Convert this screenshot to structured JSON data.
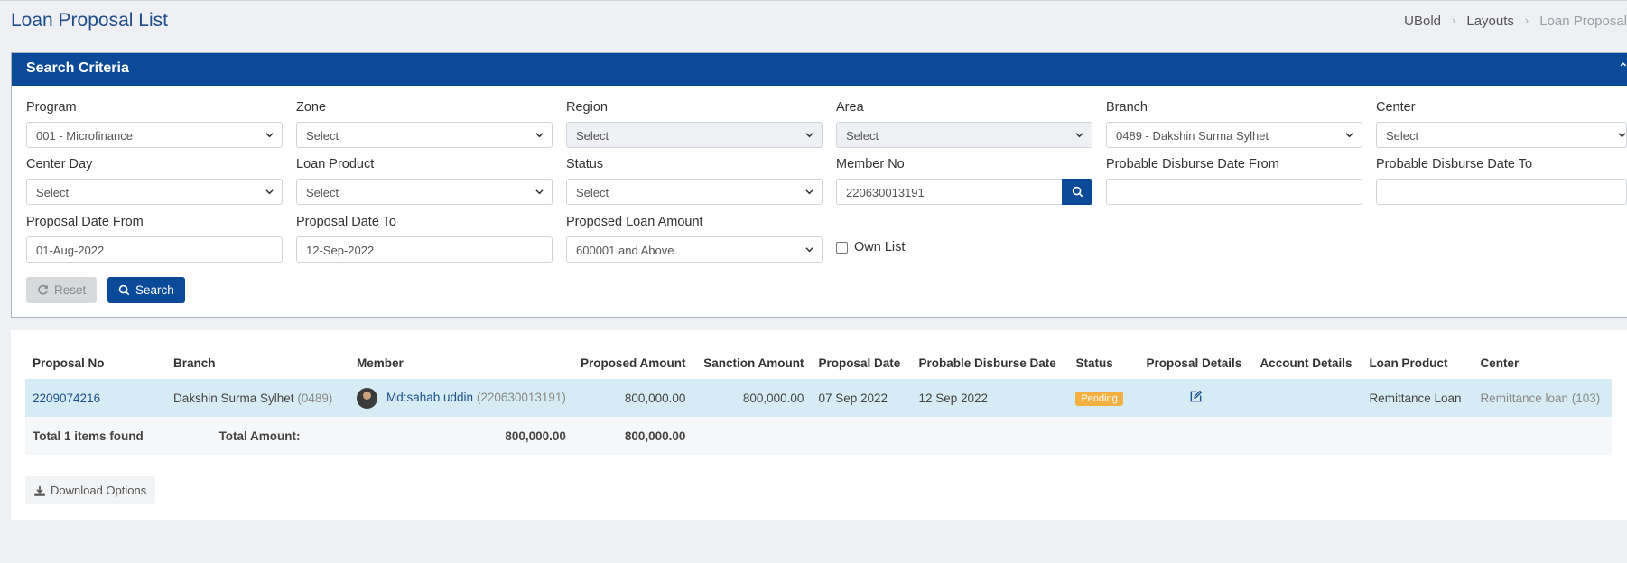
{
  "header": {
    "title": "Loan Proposal List",
    "breadcrumb": [
      "UBold",
      "Layouts",
      "Loan Proposal"
    ]
  },
  "search": {
    "title": "Search Criteria",
    "fields": {
      "program": {
        "label": "Program",
        "value": "001 - Microfinance"
      },
      "zone": {
        "label": "Zone",
        "value": "Select"
      },
      "region": {
        "label": "Region",
        "value": "Select"
      },
      "area": {
        "label": "Area",
        "value": "Select"
      },
      "branch": {
        "label": "Branch",
        "value": "0489 - Dakshin Surma Sylhet"
      },
      "center": {
        "label": "Center",
        "value": "Select"
      },
      "center_day": {
        "label": "Center Day",
        "value": "Select"
      },
      "loan_product": {
        "label": "Loan Product",
        "value": "Select"
      },
      "status": {
        "label": "Status",
        "value": "Select"
      },
      "member_no": {
        "label": "Member No",
        "value": "220630013191"
      },
      "disburse_from": {
        "label": "Probable Disburse Date From",
        "value": ""
      },
      "disburse_to": {
        "label": "Probable Disburse Date To",
        "value": ""
      },
      "proposal_from": {
        "label": "Proposal Date From",
        "value": "01-Aug-2022"
      },
      "proposal_to": {
        "label": "Proposal Date To",
        "value": "12-Sep-2022"
      },
      "loan_amount": {
        "label": "Proposed Loan Amount",
        "value": "600001 and Above"
      }
    },
    "own_list_label": "Own List",
    "reset_label": "Reset",
    "search_label": "Search"
  },
  "results": {
    "columns": [
      "Proposal No",
      "Branch",
      "Member",
      "Proposed Amount",
      "Sanction Amount",
      "Proposal Date",
      "Probable Disburse Date",
      "Status",
      "Proposal Details",
      "Account Details",
      "Loan Product",
      "Center"
    ],
    "rows": [
      {
        "proposal_no": "2209074216",
        "branch": "Dakshin Surma Sylhet",
        "branch_code": "(0489)",
        "member": "Md:sahab uddin",
        "member_no": "(220630013191)",
        "proposed_amount": "800,000.00",
        "sanction_amount": "800,000.00",
        "proposal_date": "07 Sep 2022",
        "disburse_date": "12 Sep 2022",
        "status": "Pending",
        "account_details": "",
        "loan_product": "Remittance Loan",
        "center": "Remittance loan (103)"
      }
    ],
    "total": {
      "prefix": "Total",
      "count": "1",
      "suffix": "items found",
      "amount_label": "Total Amount:",
      "proposed_total": "800,000.00",
      "sanction_total": "800,000.00"
    },
    "download_label": "Download Options"
  },
  "colors": {
    "primary": "#0b4a98",
    "pending": "#f5b041",
    "row_highlight": "#d6ecf4"
  }
}
